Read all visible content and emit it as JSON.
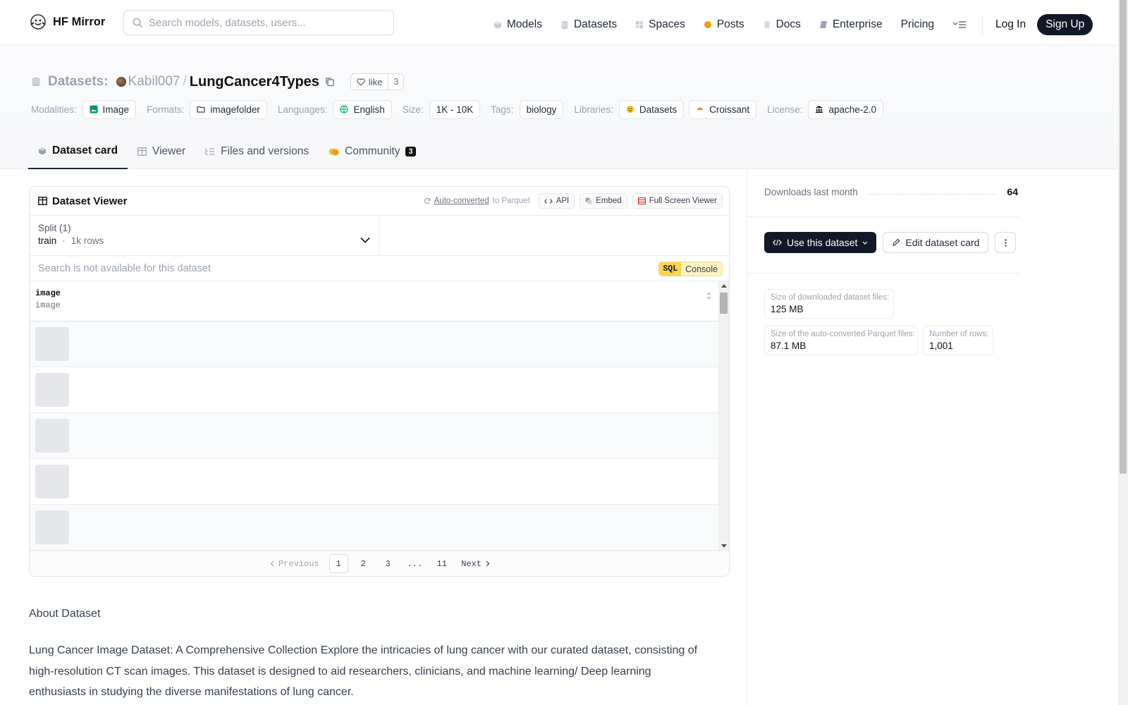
{
  "nav": {
    "brand": "HF Mirror",
    "search_placeholder": "Search models, datasets, users...",
    "links": [
      "Models",
      "Datasets",
      "Spaces",
      "Posts",
      "Docs",
      "Enterprise",
      "Pricing"
    ],
    "login": "Log In",
    "signup": "Sign Up"
  },
  "header": {
    "section_label": "Datasets:",
    "owner": "Kabil007",
    "separator": "/",
    "repo": "LungCancer4Types",
    "like_label": "like",
    "like_count": "3",
    "tags": {
      "modalities_label": "Modalities:",
      "modality": "Image",
      "formats_label": "Formats:",
      "format": "imagefolder",
      "languages_label": "Languages:",
      "language": "English",
      "size_label": "Size:",
      "size": "1K - 10K",
      "tags_label": "Tags:",
      "tag": "biology",
      "libraries_label": "Libraries:",
      "library1": "Datasets",
      "library2": "Croissant",
      "license_label": "License:",
      "license": "apache-2.0"
    },
    "tabs": {
      "card": "Dataset card",
      "viewer": "Viewer",
      "files": "Files and versions",
      "community": "Community",
      "community_count": "3"
    }
  },
  "viewer": {
    "title": "Dataset Viewer",
    "auto_converted": "Auto-converted",
    "to_parquet": "to Parquet",
    "api": "API",
    "embed": "Embed",
    "fullscreen": "Full Screen Viewer",
    "split_label": "Split (1)",
    "split_name": "train",
    "split_dot": "·",
    "split_rows": "1k rows",
    "search_placeholder": "Search is not available for this dataset",
    "sql": "SQL",
    "console": "Console",
    "column_name": "image",
    "column_type": "image",
    "pager": {
      "previous": "Previous",
      "pages": [
        "1",
        "2",
        "3",
        "...",
        "11"
      ],
      "next": "Next"
    }
  },
  "about": {
    "title": "About Dataset",
    "text": "Lung Cancer Image Dataset: A Comprehensive Collection Explore the intricacies of lung cancer with our curated dataset, consisting of high-resolution CT scan images. This dataset is designed to aid researchers, clinicians, and machine learning/ Deep learning enthusiasts in studying the diverse manifestations of lung cancer."
  },
  "sidebar": {
    "downloads_label": "Downloads last month",
    "downloads_value": "64",
    "use_dataset": "Use this dataset",
    "edit_card": "Edit dataset card",
    "stats": {
      "download_size_label": "Size of downloaded dataset files:",
      "download_size": "125 MB",
      "parquet_size_label": "Size of the auto-converted Parquet files:",
      "parquet_size": "87.1 MB",
      "rows_label": "Number of rows:",
      "rows": "1,001"
    }
  },
  "colors": {
    "accent_dark": "#111827",
    "sql_yellow": "#fcd34d",
    "muted_text": "#9ca3af"
  }
}
